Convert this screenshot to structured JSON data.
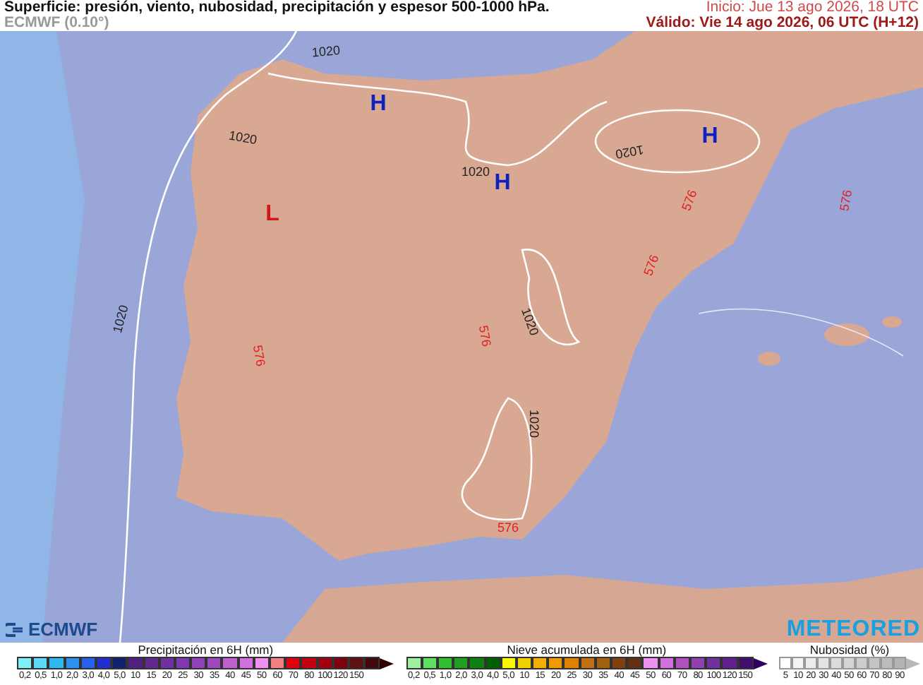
{
  "header": {
    "title": "Superficie: presión, viento, nubosidad, precipitación y espesor 500-1000 hPa.",
    "model": "ECMWF (0.10°)",
    "start": "Inicio: Jue 13 ago 2026, 18 UTC",
    "valid": "Válido: Vie 14 ago 2026, 06 UTC (H+12)"
  },
  "map": {
    "labels": [
      {
        "kind": "isobar",
        "text": "1020"
      },
      {
        "kind": "isobar",
        "text": "1020"
      },
      {
        "kind": "isobar",
        "text": "1020"
      },
      {
        "kind": "isobar",
        "text": "1020"
      },
      {
        "kind": "isobar",
        "text": "1020"
      },
      {
        "kind": "isobar",
        "text": "1020"
      },
      {
        "kind": "isobar",
        "text": "1020"
      },
      {
        "kind": "thickness",
        "text": "576"
      },
      {
        "kind": "thickness",
        "text": "576"
      },
      {
        "kind": "thickness",
        "text": "576"
      },
      {
        "kind": "thickness",
        "text": "576"
      },
      {
        "kind": "thickness",
        "text": "576"
      },
      {
        "kind": "thickness",
        "text": "576"
      },
      {
        "kind": "high",
        "text": "H"
      },
      {
        "kind": "high",
        "text": "H"
      },
      {
        "kind": "high",
        "text": "H"
      },
      {
        "kind": "low",
        "text": "L"
      }
    ],
    "logos": [
      {
        "kind": "left",
        "text": "ECMWF"
      },
      {
        "kind": "right",
        "text": "METEORED"
      }
    ]
  },
  "legends": [
    {
      "title": "Precipitación en 6H (mm)",
      "arrow": {
        "color": "#300000"
      },
      "ticks": [
        "0,2",
        "0,5",
        "1,0",
        "2,0",
        "3,0",
        "4,0",
        "5,0",
        "10",
        "15",
        "20",
        "25",
        "30",
        "35",
        "40",
        "45",
        "50",
        "60",
        "70",
        "80",
        "100",
        "120",
        "150"
      ],
      "swatches": [
        {
          "color": "#80f0f8"
        },
        {
          "color": "#60d8f8"
        },
        {
          "color": "#30b8f0"
        },
        {
          "color": "#3090f0"
        },
        {
          "color": "#2860f0"
        },
        {
          "color": "#2030d0"
        },
        {
          "color": "#102070"
        },
        {
          "color": "#502080"
        },
        {
          "color": "#602890"
        },
        {
          "color": "#7030a0"
        },
        {
          "color": "#8038b0"
        },
        {
          "color": "#9040b8"
        },
        {
          "color": "#a048c0"
        },
        {
          "color": "#c060d0"
        },
        {
          "color": "#d070e0"
        },
        {
          "color": "#f090f0"
        },
        {
          "color": "#f08080"
        },
        {
          "color": "#e00010"
        },
        {
          "color": "#c00010"
        },
        {
          "color": "#a00010"
        },
        {
          "color": "#800010"
        },
        {
          "color": "#601010"
        },
        {
          "color": "#400808"
        }
      ]
    },
    {
      "title": "Nieve acumulada en 6H (mm)",
      "arrow": {
        "color": "#300060"
      },
      "ticks": [
        "0,2",
        "0,5",
        "1,0",
        "2,0",
        "3,0",
        "4,0",
        "5,0",
        "10",
        "15",
        "20",
        "25",
        "30",
        "35",
        "40",
        "45",
        "50",
        "60",
        "70",
        "80",
        "100",
        "120",
        "150"
      ],
      "swatches": [
        {
          "color": "#a0f0a0"
        },
        {
          "color": "#60e060"
        },
        {
          "color": "#30c030"
        },
        {
          "color": "#20a020"
        },
        {
          "color": "#108010"
        },
        {
          "color": "#006000"
        },
        {
          "color": "#f8f800"
        },
        {
          "color": "#f0d000"
        },
        {
          "color": "#f0b000"
        },
        {
          "color": "#f09800"
        },
        {
          "color": "#e08000"
        },
        {
          "color": "#c07010"
        },
        {
          "color": "#a06010"
        },
        {
          "color": "#804010"
        },
        {
          "color": "#603010"
        },
        {
          "color": "#f090f0"
        },
        {
          "color": "#d070e0"
        },
        {
          "color": "#b050c0"
        },
        {
          "color": "#9040b0"
        },
        {
          "color": "#7030a0"
        },
        {
          "color": "#602090"
        },
        {
          "color": "#401070"
        }
      ]
    },
    {
      "title": "Nubosidad (%)",
      "arrow": {
        "color": "#b8b8b8"
      },
      "ticks": [
        "5",
        "10",
        "20",
        "30",
        "40",
        "50",
        "60",
        "70",
        "80",
        "90"
      ],
      "swatches": [
        {
          "color": "#ffffff"
        },
        {
          "color": "#f4f4f4"
        },
        {
          "color": "#ececec"
        },
        {
          "color": "#e4e4e4"
        },
        {
          "color": "#dcdcdc"
        },
        {
          "color": "#d4d4d4"
        },
        {
          "color": "#cccccc"
        },
        {
          "color": "#c4c4c4"
        },
        {
          "color": "#bcbcbc"
        },
        {
          "color": "#b4b4b4"
        }
      ]
    }
  ]
}
